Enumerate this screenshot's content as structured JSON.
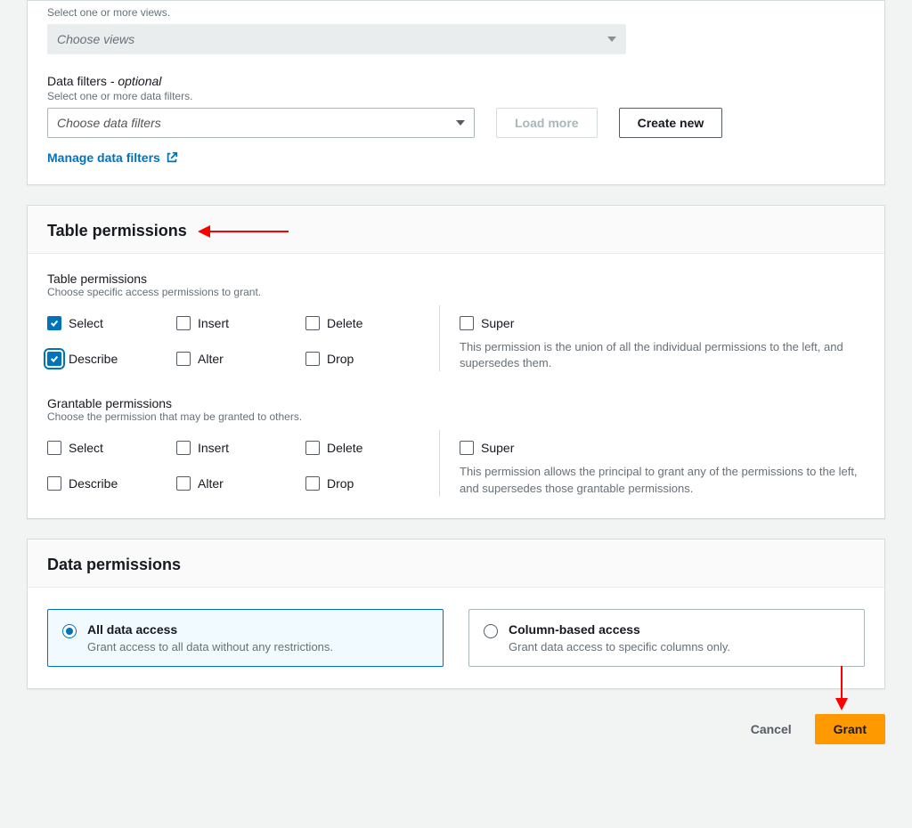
{
  "top": {
    "views_helper": "Select one or more views.",
    "views_placeholder": "Choose views",
    "filters_label": "Data filters",
    "filters_optional": " - optional",
    "filters_helper": "Select one or more data filters.",
    "filters_placeholder": "Choose data filters",
    "load_more": "Load more",
    "create_new": "Create new",
    "manage_filters": "Manage data filters"
  },
  "tableperm": {
    "header": "Table permissions",
    "sub_title": "Table permissions",
    "sub_helper": "Choose specific access permissions to grant.",
    "items": {
      "select": "Select",
      "insert": "Insert",
      "delete": "Delete",
      "describe": "Describe",
      "alter": "Alter",
      "drop": "Drop"
    },
    "super": "Super",
    "super_desc": "This permission is the union of all the individual permissions to the left, and supersedes them.",
    "grant_title": "Grantable permissions",
    "grant_helper": "Choose the permission that may be granted to others.",
    "grant_super_desc": "This permission allows the principal to grant any of the permissions to the left, and supersedes those grantable permissions."
  },
  "dataperm": {
    "header": "Data permissions",
    "all_title": "All data access",
    "all_desc": "Grant access to all data without any restrictions.",
    "col_title": "Column-based access",
    "col_desc": "Grant data access to specific columns only."
  },
  "footer": {
    "cancel": "Cancel",
    "grant": "Grant"
  }
}
